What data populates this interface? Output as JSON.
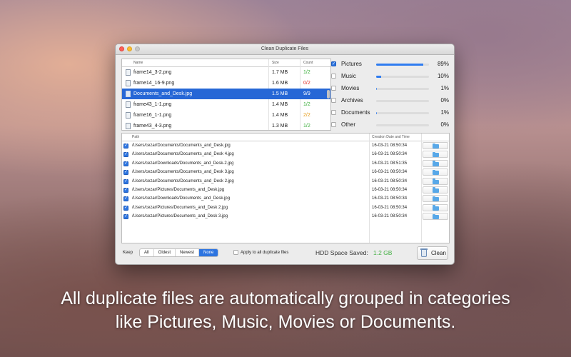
{
  "window": {
    "title": "Clean Duplicate Files"
  },
  "files_table": {
    "columns": {
      "name": "Name",
      "size": "Size",
      "count": "Count"
    },
    "rows": [
      {
        "name": "frame14_3-2.png",
        "size": "1.7 MB",
        "count": "1/2",
        "count_color": "#3cae3c",
        "selected": false
      },
      {
        "name": "frame14_16-9.png",
        "size": "1.6 MB",
        "count": "0/2",
        "count_color": "#e0322b",
        "selected": false
      },
      {
        "name": "Documents_and_Desk.jpg",
        "size": "1.5 MB",
        "count": "9/9",
        "count_color": "#e0322b",
        "selected": true
      },
      {
        "name": "frame43_1-1.png",
        "size": "1.4 MB",
        "count": "1/2",
        "count_color": "#3cae3c",
        "selected": false
      },
      {
        "name": "frame16_1-1.png",
        "size": "1.4 MB",
        "count": "2/2",
        "count_color": "#e69b17",
        "selected": false
      },
      {
        "name": "frame43_4-3.png",
        "size": "1.3 MB",
        "count": "1/2",
        "count_color": "#3cae3c",
        "selected": false
      }
    ]
  },
  "categories": [
    {
      "label": "Pictures",
      "percent": "89%",
      "fill": 0.89,
      "checked": true
    },
    {
      "label": "Music",
      "percent": "10%",
      "fill": 0.1,
      "checked": false
    },
    {
      "label": "Movies",
      "percent": "1%",
      "fill": 0.01,
      "checked": false
    },
    {
      "label": "Archives",
      "percent": "0%",
      "fill": 0.0,
      "checked": false
    },
    {
      "label": "Documents",
      "percent": "1%",
      "fill": 0.01,
      "checked": false
    },
    {
      "label": "Other",
      "percent": "0%",
      "fill": 0.0,
      "checked": false
    }
  ],
  "paths_table": {
    "columns": {
      "path": "Path",
      "date": "Creation Date and Time"
    },
    "rows": [
      {
        "path": "/Users/cezar/Documents/Documents_and_Desk.jpg",
        "date": "16-03-21 08:50:34"
      },
      {
        "path": "/Users/cezar/Documents/Documents_and_Desk 4.jpg",
        "date": "16-03-21 08:50:34"
      },
      {
        "path": "/Users/cezar/Downloads/Documents_and_Desk-2.jpg",
        "date": "16-03-21 08:51:35"
      },
      {
        "path": "/Users/cezar/Documents/Documents_and_Desk 3.jpg",
        "date": "16-03-21 08:50:34"
      },
      {
        "path": "/Users/cezar/Documents/Documents_and_Desk 2.jpg",
        "date": "16-03-21 08:50:34"
      },
      {
        "path": "/Users/cezar/Pictures/Documents_and_Desk.jpg",
        "date": "16-03-21 08:50:34"
      },
      {
        "path": "/Users/cezar/Downloads/Documents_and_Desk.jpg",
        "date": "16-03-21 08:50:34"
      },
      {
        "path": "/Users/cezar/Pictures/Documents_and_Desk 2.jpg",
        "date": "16-03-21 08:50:34"
      },
      {
        "path": "/Users/cezar/Pictures/Documents_and_Desk 3.jpg",
        "date": "16-03-21 08:50:34"
      }
    ]
  },
  "bottom": {
    "keep_label": "Keep",
    "keep_options": [
      "All",
      "Oldest",
      "Newest",
      "None"
    ],
    "keep_selected": "None",
    "apply_all_label": "Apply to all duplicate files",
    "hdd_label": "HDD Space Saved:",
    "hdd_value": "1.2 GB",
    "clean_label": "Clean"
  },
  "caption": {
    "line1": "All duplicate files are automatically grouped in categories",
    "line2": "like Pictures, Music, Movies or Documents."
  }
}
